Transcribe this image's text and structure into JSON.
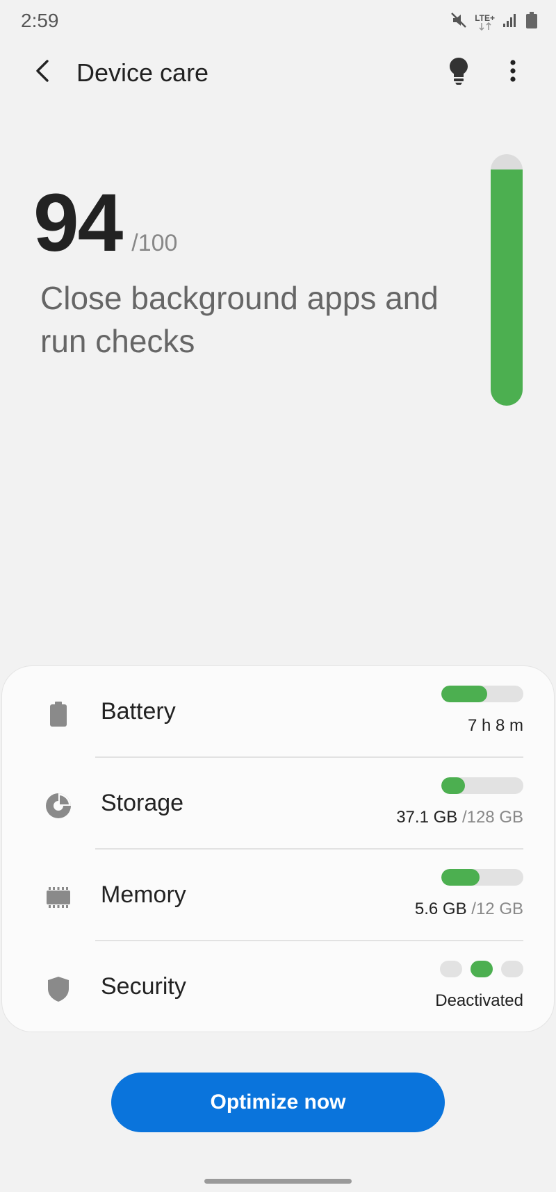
{
  "status_bar": {
    "time": "2:59",
    "network_label": "LTE+",
    "icons": [
      "mute-icon",
      "lte-icon",
      "signal-icon",
      "battery-icon"
    ]
  },
  "header": {
    "title": "Device care",
    "back_icon": "back-arrow-icon",
    "tips_icon": "lightbulb-icon",
    "more_icon": "more-options-icon"
  },
  "score": {
    "value": "94",
    "max": "/100",
    "fraction": 0.94,
    "message": "Close background apps and run checks"
  },
  "items": [
    {
      "key": "battery",
      "label": "Battery",
      "icon": "battery-icon",
      "value": "7 h 8 m",
      "total": "",
      "fraction": 0.56
    },
    {
      "key": "storage",
      "label": "Storage",
      "icon": "storage-pie-icon",
      "value": "37.1 GB",
      "total": "/128 GB",
      "fraction": 0.29
    },
    {
      "key": "memory",
      "label": "Memory",
      "icon": "memory-chip-icon",
      "value": "5.6 GB",
      "total": "/12 GB",
      "fraction": 0.47
    },
    {
      "key": "security",
      "label": "Security",
      "icon": "shield-icon",
      "value": "Deactivated",
      "total": "",
      "level": 2,
      "levels": 3
    }
  ],
  "actions": {
    "optimize_label": "Optimize now"
  },
  "colors": {
    "accent_green": "#4caf50",
    "button_blue": "#0a74dc",
    "background": "#f2f2f2"
  }
}
